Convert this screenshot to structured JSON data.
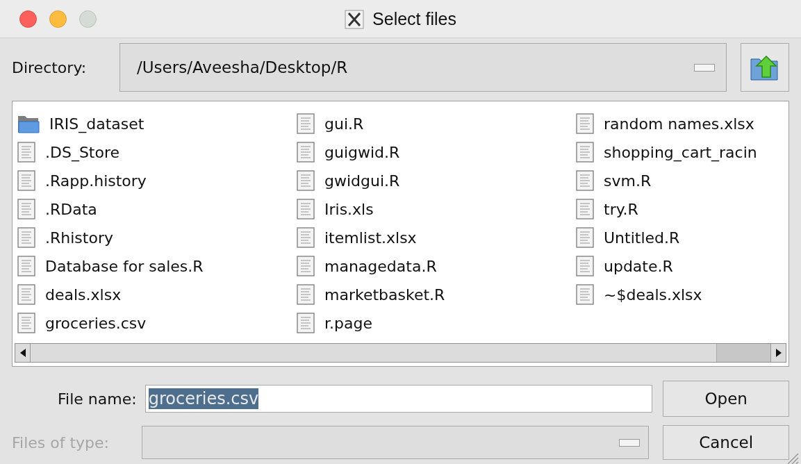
{
  "window": {
    "title": "Select files",
    "buttons": [
      {
        "kind": "close",
        "disabled": false
      },
      {
        "kind": "minimize",
        "disabled": false
      },
      {
        "kind": "zoom",
        "disabled": true
      }
    ]
  },
  "directory": {
    "label": "Directory:",
    "value": "/Users/Aveesha/Desktop/R"
  },
  "files": [
    {
      "name": "IRIS_dataset",
      "kind": "folder"
    },
    {
      "name": ".DS_Store",
      "kind": "file"
    },
    {
      "name": ".Rapp.history",
      "kind": "file"
    },
    {
      "name": ".RData",
      "kind": "file"
    },
    {
      "name": ".Rhistory",
      "kind": "file"
    },
    {
      "name": "Database for sales.R",
      "kind": "file"
    },
    {
      "name": "deals.xlsx",
      "kind": "file"
    },
    {
      "name": "groceries.csv",
      "kind": "file"
    },
    {
      "name": "gui.R",
      "kind": "file"
    },
    {
      "name": "guigwid.R",
      "kind": "file"
    },
    {
      "name": "gwidgui.R",
      "kind": "file"
    },
    {
      "name": "Iris.xls",
      "kind": "file"
    },
    {
      "name": "itemlist.xlsx",
      "kind": "file"
    },
    {
      "name": "managedata.R",
      "kind": "file"
    },
    {
      "name": "marketbasket.R",
      "kind": "file"
    },
    {
      "name": "r.page",
      "kind": "file"
    },
    {
      "name": "random names.xlsx",
      "kind": "file"
    },
    {
      "name": "shopping_cart_racin",
      "kind": "file"
    },
    {
      "name": "svm.R",
      "kind": "file"
    },
    {
      "name": "try.R",
      "kind": "file"
    },
    {
      "name": "Untitled.R",
      "kind": "file"
    },
    {
      "name": "update.R",
      "kind": "file"
    },
    {
      "name": "~$deals.xlsx",
      "kind": "file"
    }
  ],
  "file_name": {
    "label": "File name:",
    "value": "groceries.csv",
    "selected": true
  },
  "files_of_type": {
    "label": "Files of type:",
    "disabled": true
  },
  "buttons": [
    {
      "label": "Open"
    },
    {
      "label": "Cancel"
    }
  ]
}
